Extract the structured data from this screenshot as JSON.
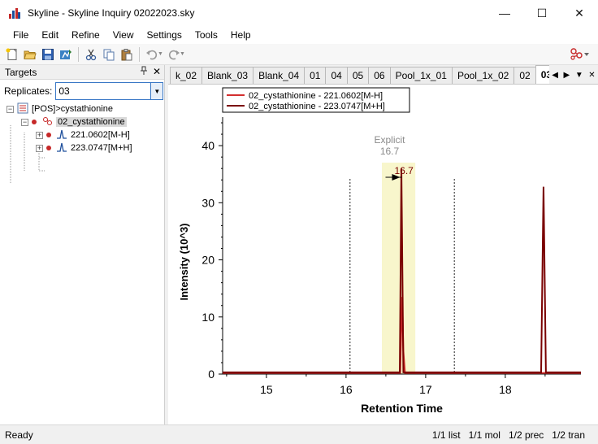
{
  "window": {
    "title": "Skyline - Skyline Inquiry 02022023.sky",
    "minimize": "—",
    "maximize": "☐",
    "close": "✕"
  },
  "menu": [
    "File",
    "Edit",
    "Refine",
    "View",
    "Settings",
    "Tools",
    "Help"
  ],
  "targets": {
    "header": "Targets",
    "pin_glyph": "📌",
    "close_glyph": "✕",
    "replicates_label": "Replicates:",
    "replicates_value": "03",
    "tree": {
      "root": "[POS]>cystathionine",
      "molecule": "02_cystathionine",
      "precursors": [
        "221.0602[M-H]",
        "223.0747[M+H]"
      ]
    }
  },
  "tabs": {
    "items": [
      "k_02",
      "Blank_03",
      "Blank_04",
      "01",
      "04",
      "05",
      "06",
      "Pool_1x_01",
      "Pool_1x_02",
      "02",
      "03"
    ],
    "active": "03"
  },
  "chart_data": {
    "type": "line",
    "xlabel": "Retention Time",
    "ylabel": "Intensity (10^3)",
    "xlim": [
      14.45,
      18.95
    ],
    "ylim": [
      0,
      45
    ],
    "xticks": [
      15,
      16,
      17,
      18
    ],
    "yticks": [
      0,
      10,
      20,
      30,
      40
    ],
    "grid": false,
    "legend_position": "top-left",
    "series": [
      {
        "name": "02_cystathionine - 221.0602[M-H]",
        "color": "#d32f2f",
        "x": [
          14.45,
          16.68,
          16.705,
          16.72,
          16.74,
          18.95
        ],
        "y": [
          0.2,
          0.2,
          13.5,
          4,
          0.2,
          0.2
        ]
      },
      {
        "name": "02_cystathionine - 223.0747[M+H]",
        "color": "#7a0000",
        "x": [
          14.45,
          16.675,
          16.695,
          16.72,
          18.45,
          18.48,
          18.51,
          18.95
        ],
        "y": [
          0.3,
          0.3,
          36,
          0.3,
          0.3,
          32.8,
          0.3,
          0.3
        ]
      }
    ],
    "integration_boundaries": [
      16.05,
      17.36
    ],
    "highlight_range": [
      16.45,
      16.87
    ],
    "explicit_annotation": {
      "label": "Explicit",
      "value": "16.7",
      "x": 16.7
    },
    "peak_label": {
      "text": "16.7",
      "x": 16.7,
      "y": 36
    }
  },
  "status": {
    "left": "Ready",
    "list": "1/1 list",
    "mol": "1/1 mol",
    "prec": "1/2 prec",
    "tran": "1/2 tran"
  },
  "colors": {
    "highlight_band": "#f8f6cc",
    "accent": "#3a78c6"
  }
}
